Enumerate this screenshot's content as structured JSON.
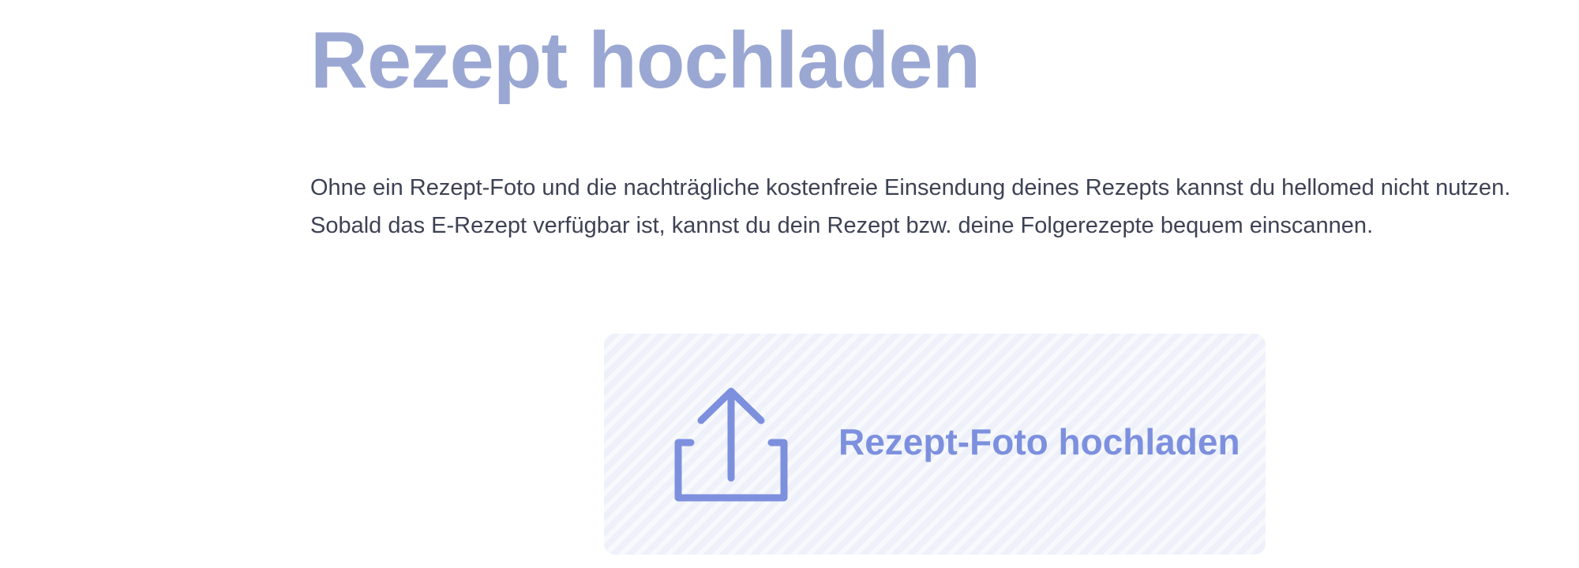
{
  "page": {
    "title": "Rezept hochladen",
    "description": "Ohne ein Rezept-Foto und die nachträgliche kostenfreie Einsendung deines Rezepts kannst du hellomed nicht nutzen. Sobald das E-Rezept verfügbar ist, kannst du dein Rezept bzw. deine Folgerezepte bequem einscannen."
  },
  "upload": {
    "label": "Rezept-Foto hochladen",
    "icon": "upload-icon"
  },
  "colors": {
    "title": "#9ba7d3",
    "text": "#3d4254",
    "accent": "#7d90de",
    "upload_bg": "#eef1fa"
  }
}
